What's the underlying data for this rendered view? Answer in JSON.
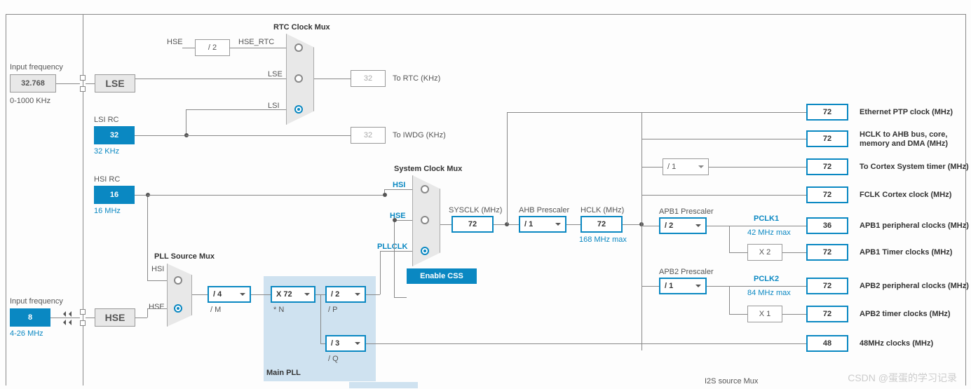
{
  "left": {
    "input_freq1_label": "Input frequency",
    "input_freq1_value": "32.768",
    "input_freq1_range": "0-1000 KHz",
    "input_freq2_label": "Input frequency",
    "input_freq2_value": "8",
    "input_freq2_range": "4-26 MHz"
  },
  "osc": {
    "lse_label": "LSE",
    "lsi_rc_label": "LSI RC",
    "lsi_value": "32",
    "lsi_unit": "32 KHz",
    "hsi_rc_label": "HSI RC",
    "hsi_value": "16",
    "hsi_unit": "16 MHz",
    "hse_label": "HSE"
  },
  "rtc_mux": {
    "title": "RTC Clock Mux",
    "hse_label": "HSE",
    "hse_div": "/ 2",
    "hse_rtc": "HSE_RTC",
    "lse_label": "LSE",
    "lsi_label": "LSI",
    "to_rtc_value": "32",
    "to_rtc_label": "To RTC (KHz)",
    "to_iwdg_value": "32",
    "to_iwdg_label": "To IWDG (KHz)"
  },
  "pll_mux": {
    "title": "PLL Source Mux",
    "hsi_label": "HSI",
    "hse_label": "HSE"
  },
  "pll": {
    "m_div": "/ 4",
    "m_label": "/ M",
    "n_mul": "X 72",
    "n_label": "* N",
    "p_div": "/ 2",
    "p_label": "/ P",
    "q_div": "/ 3",
    "q_label": "/ Q",
    "main_label": "Main PLL"
  },
  "sys_mux": {
    "title": "System Clock Mux",
    "hsi_label": "HSI",
    "hse_label": "HSE",
    "pllclk_label": "PLLCLK",
    "enable_css": "Enable CSS"
  },
  "main": {
    "sysclk_label": "SYSCLK (MHz)",
    "sysclk_value": "72",
    "ahb_label": "AHB Prescaler",
    "ahb_value": "/ 1",
    "hclk_label": "HCLK (MHz)",
    "hclk_value": "72",
    "hclk_max": "168 MHz max"
  },
  "right": {
    "apb1_label": "APB1 Prescaler",
    "apb1_value": "/ 2",
    "pclk1_label": "PCLK1",
    "pclk1_max": "42 MHz max",
    "apb1_x2": "X 2",
    "apb2_label": "APB2 Prescaler",
    "apb2_value": "/ 1",
    "pclk2_label": "PCLK2",
    "pclk2_max": "84 MHz max",
    "apb2_x1": "X 1",
    "cortex_div": "/ 1"
  },
  "outputs": {
    "eth_ptp": {
      "value": "72",
      "label": "Ethernet PTP clock (MHz)"
    },
    "hclk_bus": {
      "value": "72",
      "label": "HCLK to AHB bus, core, memory and DMA (MHz)"
    },
    "cortex_timer": {
      "value": "72",
      "label": "To Cortex System timer (MHz)"
    },
    "fclk": {
      "value": "72",
      "label": "FCLK Cortex clock (MHz)"
    },
    "apb1_periph": {
      "value": "36",
      "label": "APB1 peripheral clocks (MHz)"
    },
    "apb1_timer": {
      "value": "72",
      "label": "APB1 Timer clocks (MHz)"
    },
    "apb2_periph": {
      "value": "72",
      "label": "APB2 peripheral clocks (MHz)"
    },
    "apb2_timer": {
      "value": "72",
      "label": "APB2 timer clocks (MHz)"
    },
    "clk48": {
      "value": "48",
      "label": "48MHz clocks (MHz)"
    }
  },
  "misc": {
    "i2s_label": "I2S source Mux",
    "watermark": "CSDN @蛋蛋的学习记录"
  }
}
